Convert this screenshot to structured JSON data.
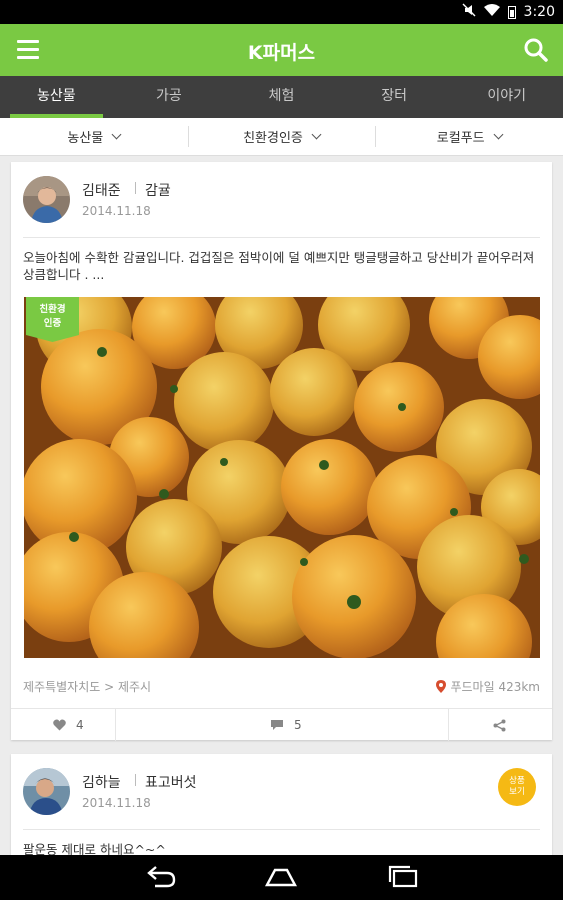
{
  "status_bar": {
    "time": "3:20",
    "icons": [
      "mute-icon",
      "wifi-icon",
      "battery-icon"
    ]
  },
  "app_bar": {
    "title": "K파머스",
    "icons": [
      "menu-icon",
      "search-icon"
    ]
  },
  "tabs": [
    {
      "label": "농산물",
      "active": true
    },
    {
      "label": "가공",
      "active": false
    },
    {
      "label": "체험",
      "active": false
    },
    {
      "label": "장터",
      "active": false
    },
    {
      "label": "이야기",
      "active": false
    }
  ],
  "filters": [
    {
      "label": "농산물"
    },
    {
      "label": "친환경인증"
    },
    {
      "label": "로컬푸드"
    }
  ],
  "posts": [
    {
      "author": "김태준",
      "category": "감귤",
      "date": "2014.11.18",
      "text": "오늘아침에 수확한 감귤입니다.  겁겁질은 점박이에 덜 예쁘지만 탱글탱글하고 당산비가 끝어우러져 상큼합니다 . ...",
      "badge": [
        "친환경",
        "인증"
      ],
      "location": "제주특별자치도 > 제주시",
      "distance": "푸드마일 423km",
      "likes": "4",
      "comments": "5"
    },
    {
      "author": "김하늘",
      "category": "표고버섯",
      "date": "2014.11.18",
      "text": "팔운동 제대로 하네요^~^",
      "view_badge": [
        "상품",
        "보기"
      ]
    }
  ],
  "colors": {
    "accent": "#7ac943",
    "tab_bar": "#3e3e3e",
    "badge": "#f5b914"
  }
}
